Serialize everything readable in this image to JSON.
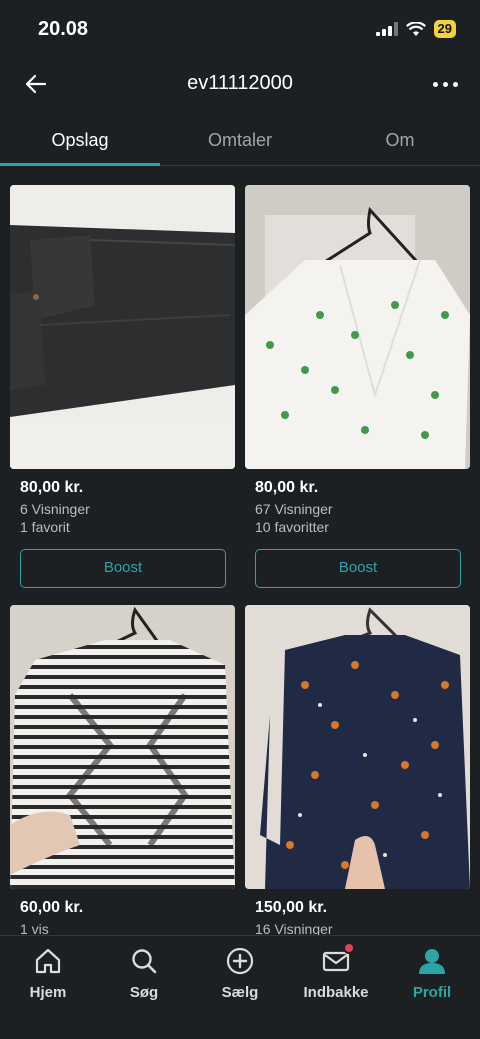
{
  "status": {
    "time": "20.08",
    "battery": "29"
  },
  "header": {
    "title": "ev11112000"
  },
  "tabs": [
    {
      "label": "Opslag",
      "active": true
    },
    {
      "label": "Omtaler",
      "active": false
    },
    {
      "label": "Om",
      "active": false
    }
  ],
  "listings": [
    {
      "price": "80,00 kr.",
      "views": "6 Visninger",
      "favorites": "1 favorit",
      "boost": "Boost"
    },
    {
      "price": "80,00 kr.",
      "views": "67 Visninger",
      "favorites": "10 favoritter",
      "boost": "Boost"
    },
    {
      "price": "60,00 kr.",
      "views": "1 vis"
    },
    {
      "price": "150,00 kr.",
      "views": "16 Visninger"
    }
  ],
  "nav": [
    {
      "label": "Hjem",
      "icon": "home-icon"
    },
    {
      "label": "Søg",
      "icon": "search-icon"
    },
    {
      "label": "Sælg",
      "icon": "plus-circle-icon"
    },
    {
      "label": "Indbakke",
      "icon": "mail-icon"
    },
    {
      "label": "Profil",
      "icon": "profile-icon",
      "active": true
    }
  ],
  "colors": {
    "accent": "#2ba6a8",
    "background": "#1c2022",
    "badge": "#e5424d"
  }
}
